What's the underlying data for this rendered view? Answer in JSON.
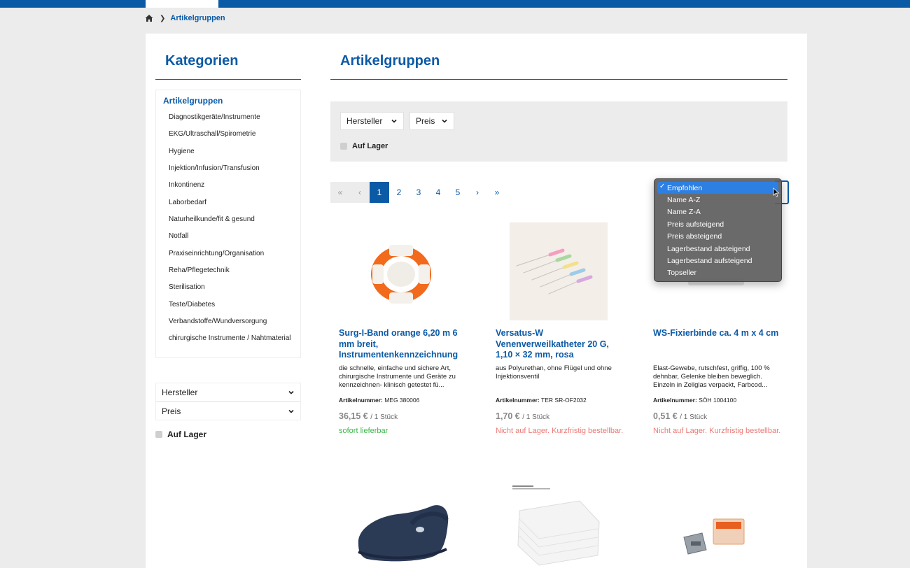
{
  "breadcrumb": {
    "current": "Artikelgruppen"
  },
  "sidebar": {
    "title": "Kategorien",
    "active_group": "Artikelgruppen",
    "categories": [
      "Diagnostikgeräte/Instrumente",
      "EKG/Ultraschall/Spirometrie",
      "Hygiene",
      "Injektion/Infusion/Transfusion",
      "Inkontinenz",
      "Laborbedarf",
      "Naturheilkunde/fit & gesund",
      "Notfall",
      "Praxiseinrichtung/Organisation",
      "Reha/Pflegetechnik",
      "Sterilisation",
      "Teste/Diabetes",
      "Verbandstoffe/Wundversorgung",
      "chirurgische Instrumente / Nahtmaterial"
    ],
    "filter_manufacturer": "Hersteller",
    "filter_price": "Preis",
    "in_stock_label": "Auf Lager"
  },
  "main": {
    "title": "Artikelgruppen",
    "filter_manufacturer": "Hersteller",
    "filter_price": "Preis",
    "in_stock_label": "Auf Lager"
  },
  "pagination": {
    "first": "«",
    "prev": "‹",
    "pages": [
      "1",
      "2",
      "3",
      "4",
      "5"
    ],
    "current": "1",
    "next": "›",
    "last": "»"
  },
  "sort": {
    "options": [
      "Empfohlen",
      "Name A-Z",
      "Name Z-A",
      "Preis aufsteigend",
      "Preis absteigend",
      "Lagerbestand absteigend",
      "Lagerbestand aufsteigend",
      "Topseller"
    ],
    "selected": "Empfohlen",
    "check_mark": "✓"
  },
  "products": [
    {
      "name": "Surg-I-Band orange 6,20 m 6 mm breit, Instrumentenkennzeichnung",
      "description": "die schnelle, einfache und sichere Art, chirurgische Instrumente und Geräte zu kennzeichnen- klinisch getestet fü...",
      "sku_label": "Artikelnummer:",
      "sku": "MEG 380006",
      "price": "36,15 €",
      "unit": "/ 1 Stück",
      "availability": "sofort lieferbar",
      "in_stock": true
    },
    {
      "name": "Versatus-W Venenverweilkatheter 20 G, 1,10 × 32 mm, rosa",
      "description": "aus Polyurethan, ohne Flügel und ohne Injektionsventil",
      "sku_label": "Artikelnummer:",
      "sku": "TER SR-OF2032",
      "price": "1,70 €",
      "unit": "/ 1 Stück",
      "availability": "Nicht auf Lager. Kurzfristig bestellbar.",
      "in_stock": false
    },
    {
      "name": "WS-Fixierbinde ca. 4 m x 4 cm",
      "description": "Elast-Gewebe, rutschfest, griffig, 100 % dehnbar, Gelenke bleiben beweglich. Einzeln in Zellglas verpackt, Farbcod...",
      "sku_label": "Artikelnummer:",
      "sku": "SÖH 1004100",
      "price": "0,51 €",
      "unit": "/ 1 Stück",
      "availability": "Nicht auf Lager. Kurzfristig bestellbar.",
      "in_stock": false
    }
  ],
  "colors": {
    "brand": "#0b5aa6",
    "in_stock": "#3bb54a",
    "out_of_stock": "#e97a76",
    "dropdown_selected": "#2d7fe2"
  }
}
